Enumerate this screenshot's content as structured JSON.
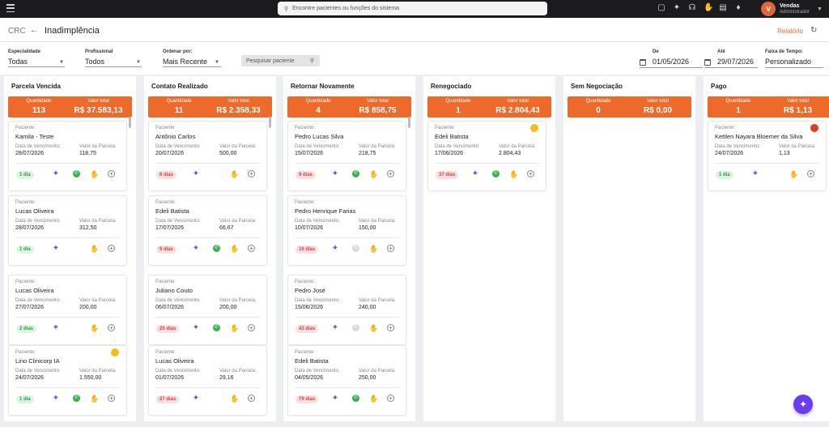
{
  "topbar": {
    "search_placeholder": "Encontre pacientes ou funções do sistema",
    "user": {
      "initial": "V",
      "name": "Vendas",
      "role": "Administrador"
    }
  },
  "header": {
    "module": "CRC",
    "title": "Inadimplência",
    "report_label": "Relatório"
  },
  "filters": {
    "especialidade_label": "Especialidade",
    "especialidade_value": "Todas",
    "profissional_label": "Profissional",
    "profissional_value": "Todos",
    "ordenar_label": "Ordenar por:",
    "ordenar_value": "Mais Recente",
    "search_placeholder": "Pesquisar paciente",
    "de_label": "De",
    "de_value": "01/05/2026",
    "ate_label": "Até",
    "ate_value": "29/07/2026",
    "faixa_label": "Faixa de Tempo:",
    "faixa_value": "Personalizado"
  },
  "labels": {
    "quantidade": "Quantidade",
    "valor_total": "Valor total",
    "paciente": "Paciente:",
    "data_vencimento": "Data de Vencimento:",
    "valor_parcela": "Valor da Parcela:"
  },
  "columns": [
    {
      "title": "Parcela Vencida",
      "quantidade": "113",
      "valor_total": "R$ 37.583,13",
      "cards": [
        {
          "paciente": "Kamila - Teste",
          "data": "28/07/2026",
          "valor": "118,75",
          "badge": "1 dia",
          "badge_color": "green",
          "whatsapp": "on",
          "dot": ""
        },
        {
          "paciente": "Lucas Oliveira",
          "data": "28/07/2026",
          "valor": "312,50",
          "badge": "1 dia",
          "badge_color": "green",
          "whatsapp": "none",
          "dot": ""
        },
        {
          "paciente": "Lucas Oliveira",
          "data": "27/07/2026",
          "valor": "200,00",
          "badge": "2 dias",
          "badge_color": "green",
          "whatsapp": "none",
          "dot": ""
        },
        {
          "paciente": "Lino Clinicorp IA",
          "data": "24/07/2026",
          "valor": "1.550,00",
          "badge": "1 dia",
          "badge_color": "green",
          "whatsapp": "on",
          "dot": "#f6bb19"
        }
      ]
    },
    {
      "title": "Contato Realizado",
      "quantidade": "11",
      "valor_total": "R$ 2.358,33",
      "cards": [
        {
          "paciente": "Antônio Carlos",
          "data": "20/07/2026",
          "valor": "500,00",
          "badge": "6 dias",
          "badge_color": "red",
          "whatsapp": "none",
          "dot": ""
        },
        {
          "paciente": "Edeli Batista",
          "data": "17/07/2026",
          "valor": "66,67",
          "badge": "9 dias",
          "badge_color": "red",
          "whatsapp": "on",
          "dot": ""
        },
        {
          "paciente": "Juliano Couto",
          "data": "06/07/2026",
          "valor": "200,00",
          "badge": "20 dias",
          "badge_color": "red",
          "whatsapp": "on",
          "dot": ""
        },
        {
          "paciente": "Lucas Oliveira",
          "data": "01/07/2026",
          "valor": "29,16",
          "badge": "27 dias",
          "badge_color": "red",
          "whatsapp": "none",
          "dot": ""
        }
      ]
    },
    {
      "title": "Retornar Novamente",
      "quantidade": "4",
      "valor_total": "R$ 858,75",
      "cards": [
        {
          "paciente": "Pedro Lucas Silva",
          "data": "15/07/2026",
          "valor": "218,75",
          "badge": "9 dias",
          "badge_color": "red",
          "whatsapp": "on",
          "dot": ""
        },
        {
          "paciente": "Pedro Henrique Farias",
          "data": "10/07/2026",
          "valor": "150,00",
          "badge": "16 dias",
          "badge_color": "red",
          "whatsapp": "off",
          "dot": ""
        },
        {
          "paciente": "Pedro José",
          "data": "15/06/2026",
          "valor": "240,00",
          "badge": "43 dias",
          "badge_color": "red",
          "whatsapp": "off",
          "dot": ""
        },
        {
          "paciente": "Edeli Batista",
          "data": "04/05/2026",
          "valor": "250,00",
          "badge": "79 dias",
          "badge_color": "red",
          "whatsapp": "on",
          "dot": ""
        }
      ]
    },
    {
      "title": "Renegociado",
      "quantidade": "1",
      "valor_total": "R$ 2.804,43",
      "cards": [
        {
          "paciente": "Edeli Batista",
          "data": "17/06/2026",
          "valor": "2.804,43",
          "badge": "37 dias",
          "badge_color": "red",
          "whatsapp": "on",
          "dot": "#f6bb19"
        }
      ]
    },
    {
      "title": "Sem Negociação",
      "quantidade": "0",
      "valor_total": "R$ 0,00",
      "cards": []
    },
    {
      "title": "Pago",
      "quantidade": "1",
      "valor_total": "R$ 1,13",
      "cards": [
        {
          "paciente": "Kettlen Nayara Bloemer da Silva",
          "data": "24/07/2026",
          "valor": "1,13",
          "badge": "1 dia",
          "badge_color": "green",
          "whatsapp": "none",
          "dot": "#e53826"
        }
      ]
    }
  ]
}
